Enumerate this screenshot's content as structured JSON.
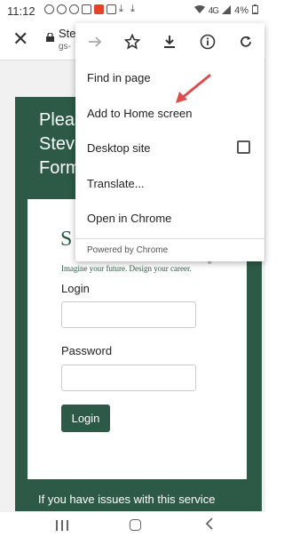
{
  "status_bar": {
    "time": "11:12",
    "network": "4G",
    "battery": "4%"
  },
  "browser": {
    "close_label": "✕",
    "title": "Ste",
    "url": "gs-"
  },
  "menu": {
    "items": [
      {
        "label": "Find in page"
      },
      {
        "label": "Add to Home screen"
      },
      {
        "label": "Desktop site"
      },
      {
        "label": "Translate..."
      },
      {
        "label": "Open in Chrome"
      }
    ],
    "desktop_site_checked": false,
    "footer": "Powered by Chrome"
  },
  "page": {
    "heading": "Please Stevens Form",
    "logo_letter": "S",
    "tagline": "Imagine your future. Design your career.",
    "tagline_mark": "®",
    "login_label": "Login",
    "password_label": "Password",
    "login_button": "Login",
    "issues_text": "If you have issues with this service"
  },
  "colors": {
    "brand_green": "#2c5a47",
    "arrow_red": "#e04b4b"
  }
}
